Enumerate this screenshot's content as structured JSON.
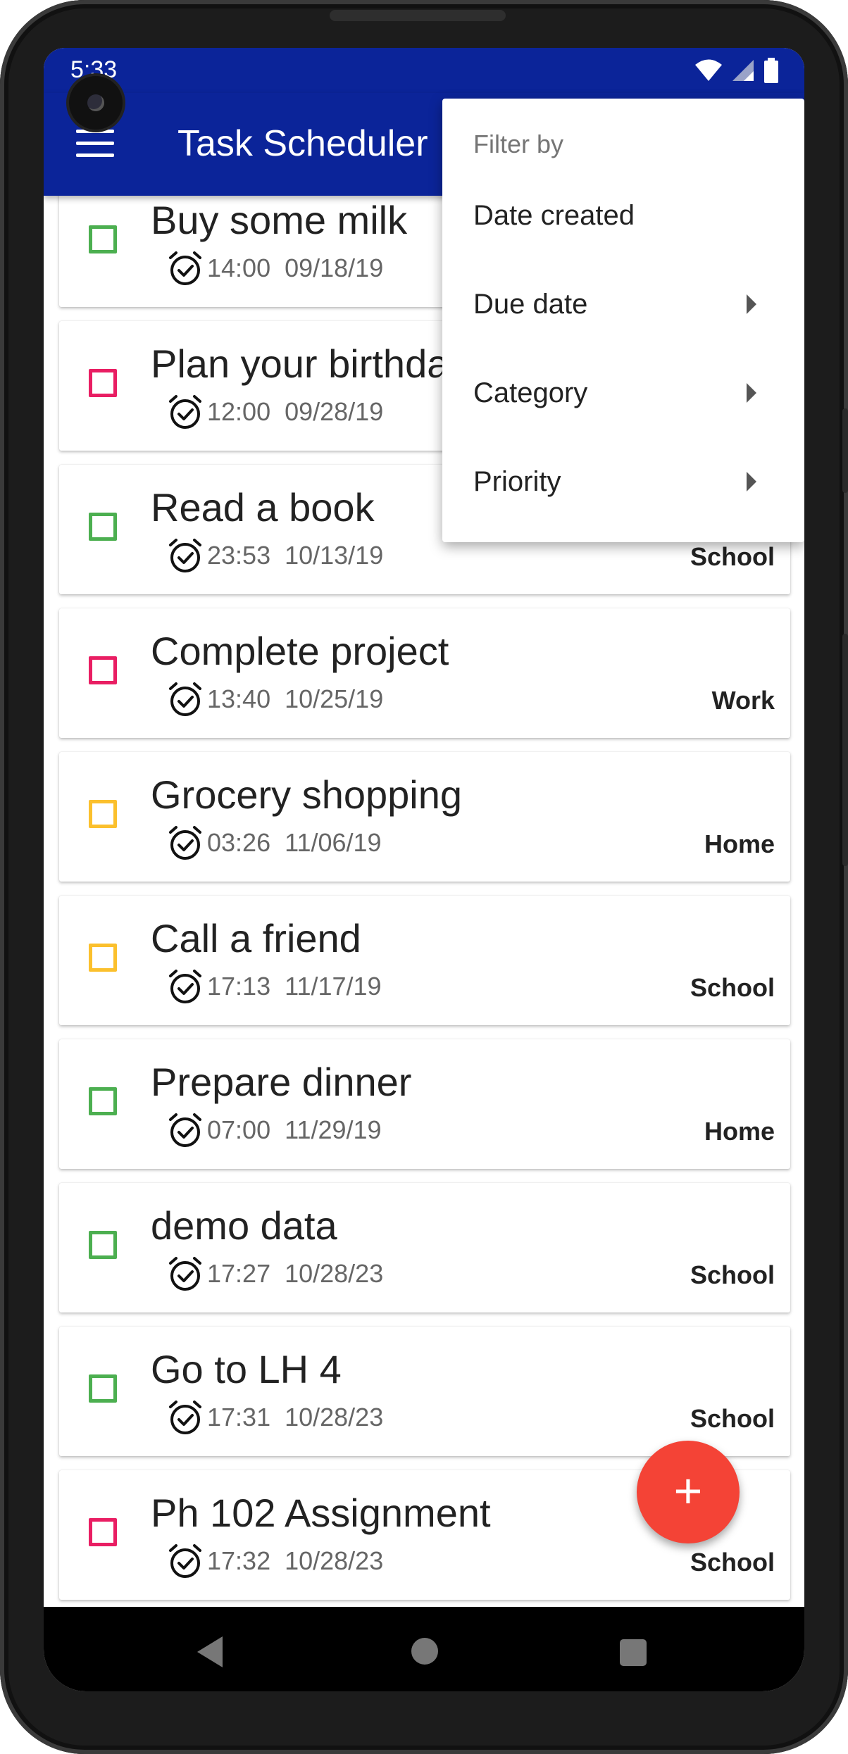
{
  "status_bar": {
    "time": "5:33",
    "icons": [
      "wifi-icon",
      "signal-icon",
      "battery-icon"
    ]
  },
  "app_bar": {
    "title": "Task Scheduler",
    "menu_icon": "hamburger-menu-icon",
    "background_color": "#0b2499"
  },
  "filter_menu": {
    "header": "Filter by",
    "items": [
      {
        "label": "Date created",
        "has_submenu": false
      },
      {
        "label": "Due date",
        "has_submenu": true
      },
      {
        "label": "Category",
        "has_submenu": true
      },
      {
        "label": "Priority",
        "has_submenu": true
      }
    ]
  },
  "tasks": [
    {
      "title": "Buy some milk",
      "time": "14:00",
      "date": "09/18/19",
      "category": "",
      "checkbox_color": "#4caf50"
    },
    {
      "title": "Plan your birthday",
      "time": "12:00",
      "date": "09/28/19",
      "category": "",
      "checkbox_color": "#e91e63"
    },
    {
      "title": "Read a book",
      "time": "23:53",
      "date": "10/13/19",
      "category": "School",
      "checkbox_color": "#4caf50"
    },
    {
      "title": "Complete project",
      "time": "13:40",
      "date": "10/25/19",
      "category": "Work",
      "checkbox_color": "#e91e63"
    },
    {
      "title": "Grocery shopping",
      "time": "03:26",
      "date": "11/06/19",
      "category": "Home",
      "checkbox_color": "#fbc02d"
    },
    {
      "title": "Call a friend",
      "time": "17:13",
      "date": "11/17/19",
      "category": "School",
      "checkbox_color": "#fbc02d"
    },
    {
      "title": "Prepare dinner",
      "time": "07:00",
      "date": "11/29/19",
      "category": "Home",
      "checkbox_color": "#4caf50"
    },
    {
      "title": "demo data",
      "time": "17:27",
      "date": "10/28/23",
      "category": "School",
      "checkbox_color": "#4caf50"
    },
    {
      "title": "Go to LH 4",
      "time": "17:31",
      "date": "10/28/23",
      "category": "School",
      "checkbox_color": "#4caf50"
    },
    {
      "title": "Ph 102 Assignment",
      "time": "17:32",
      "date": "10/28/23",
      "category": "School",
      "checkbox_color": "#e91e63"
    }
  ],
  "fab": {
    "label": "+",
    "color": "#f44336"
  },
  "nav_bar": {
    "icons": [
      "back-icon",
      "home-icon",
      "recent-apps-icon"
    ]
  }
}
